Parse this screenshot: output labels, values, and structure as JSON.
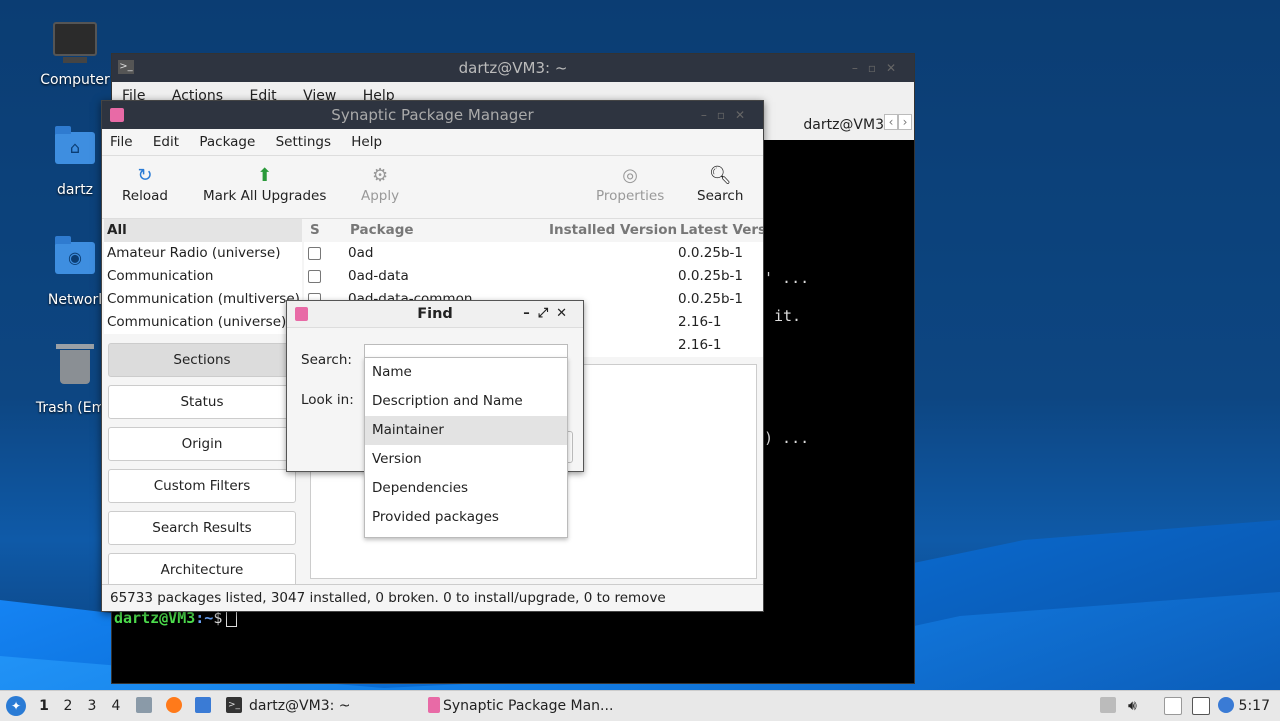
{
  "desktop": {
    "icons": [
      {
        "label": "Computer"
      },
      {
        "label": "dartz"
      },
      {
        "label": "Networl"
      },
      {
        "label": "Trash (Emp"
      }
    ]
  },
  "terminal": {
    "title": "dartz@VM3: ~",
    "menu": [
      "File",
      "Actions",
      "Edit",
      "View",
      "Help"
    ],
    "tab_label": "dartz@VM3",
    "text_lines": [
      "' ...",
      "it.",
      ") ..."
    ],
    "prompt_user": "dartz@VM3",
    "prompt_path": ":~",
    "prompt_symbol": "$"
  },
  "synaptic": {
    "title": "Synaptic Package Manager",
    "menu": [
      "File",
      "Edit",
      "Package",
      "Settings",
      "Help"
    ],
    "toolbar": {
      "reload": "Reload",
      "mark_all": "Mark All Upgrades",
      "apply": "Apply",
      "properties": "Properties",
      "search": "Search"
    },
    "categories": [
      "All",
      "Amateur Radio (universe)",
      "Communication",
      "Communication (multiverse)",
      "Communication (universe)"
    ],
    "side_buttons": [
      "Sections",
      "Status",
      "Origin",
      "Custom Filters",
      "Search Results",
      "Architecture"
    ],
    "columns": {
      "s": "S",
      "package": "Package",
      "installed": "Installed Version",
      "latest": "Latest Vers"
    },
    "packages": [
      {
        "name": "0ad",
        "latest": "0.0.25b-1"
      },
      {
        "name": "0ad-data",
        "latest": "0.0.25b-1"
      },
      {
        "name": "0ad-data-common",
        "latest": "0.0.25b-1"
      },
      {
        "name": "",
        "latest": "2.16-1"
      },
      {
        "name": "",
        "latest": "2.16-1"
      }
    ],
    "status": "65733 packages listed, 3047 installed, 0 broken. 0 to install/upgrade, 0 to remove"
  },
  "find_dialog": {
    "title": "Find",
    "search_label": "Search:",
    "lookin_label": "Look in:",
    "options": [
      "Name",
      "Description and Name",
      "Maintainer",
      "Version",
      "Dependencies",
      "Provided packages"
    ],
    "highlighted": "Maintainer"
  },
  "taskbar": {
    "workspaces": [
      "1",
      "2",
      "3",
      "4"
    ],
    "tasks": [
      "dartz@VM3: ~",
      "Synaptic Package Man..."
    ],
    "clock": "5:17"
  },
  "colors": {
    "accent": "#2a7bd5",
    "titlebar": "#2e3440",
    "prompt_user": "#4ee14e",
    "prompt_path": "#6ea8ff"
  }
}
